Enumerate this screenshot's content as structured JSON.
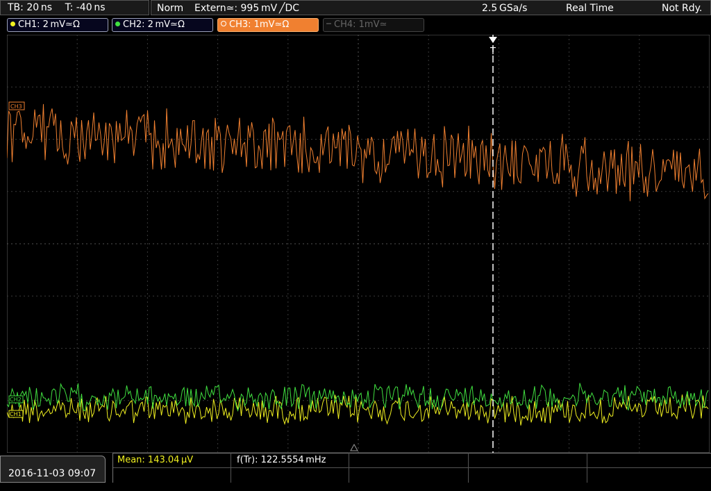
{
  "status": {
    "timebase": "TB: 20 ns",
    "trigger_pos": "T: -40 ns",
    "trigger_mode": "Norm",
    "trigger_source": "Extern≃: 995 mV ╱DC",
    "sample_rate": "2.5 GSa/s",
    "acq_mode": "Real Time",
    "state": "Not Rdy."
  },
  "channels": [
    {
      "label": "CH1: 2 mV≃Ω",
      "color": "#f0f020",
      "active": true
    },
    {
      "label": "CH2: 2 mV≃Ω",
      "color": "#40e040",
      "active": true
    },
    {
      "label": "CH3: 1mV≃Ω",
      "color": "#f08030",
      "active": true
    },
    {
      "label": "CH4: 1mV≃",
      "color": "#555555",
      "active": false
    }
  ],
  "markers": {
    "ch3": "CH3",
    "ch2": "CH2",
    "ch1": "CH1",
    "trigger": "T"
  },
  "footer": {
    "datetime": "2016-11-03 09:07",
    "mean": "Mean: 143.04 µV",
    "freq": "f(Tr): 122.5554 mHz"
  },
  "colors": {
    "grid": "#3a3a3a",
    "ch3_trace": "#f08030",
    "ch2_trace": "#40e040",
    "ch1_trace": "#f0f020",
    "mean_text": "#f0f020"
  }
}
